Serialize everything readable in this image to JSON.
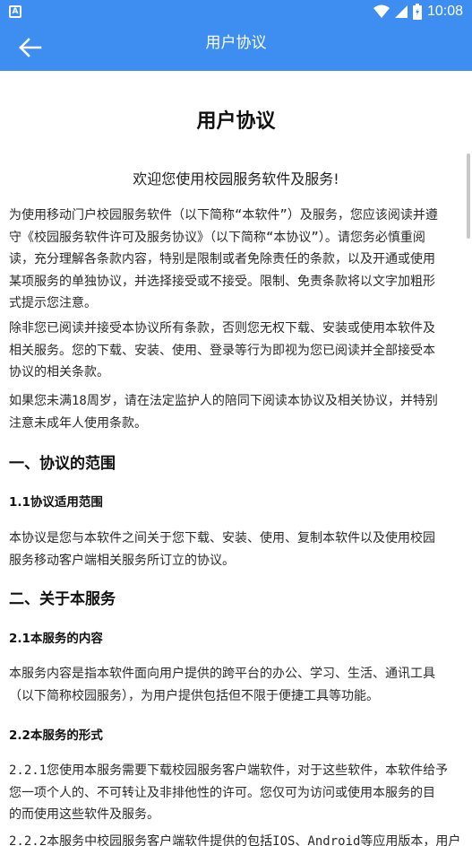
{
  "status_bar": {
    "time": "10:08",
    "left_icon": "A",
    "icons": [
      "wifi-icon",
      "signal-icon",
      "battery-icon"
    ]
  },
  "app_bar": {
    "title": "用户协议",
    "back_icon": "arrow-left-icon"
  },
  "document": {
    "title": "用户协议",
    "welcome": "欢迎您使用校园服务软件及服务!",
    "paragraphs": {
      "p1": "为使用移动门户校园服务软件（以下简称“本软件”）及服务，您应该阅读并遵\n守《校园服务软件许可及服务协议》（以下简称“本协议”）。请您务必慎重阅\n读，充分理解各条款内容，特别是限制或者免除责任的条款，以及开通或使用\n某项服务的单独协议，并选择接受或不接受。限制、免责条款将以文字加粗形\n式提示您注意。",
      "p2": "除非您已阅读并接受本协议所有条款，否则您无权下载、安装或使用本软件及\n相关服务。您的下载、安装、使用、登录等行为即视为您已阅读并全部接受本\n协议的相关条款。",
      "p3": "如果您未满18周岁，请在法定监护人的陪同下阅读本协议及相关协议，并特别\n注意未成年人使用条款。",
      "p4": "本协议是您与本软件之间关于您下载、安装、使用、复制本软件以及使用校园\n服务移动客户端相关服务所订立的协议。",
      "p5": "本服务内容是指本软件面向用户提供的跨平台的办公、学习、生活、通讯工具\n（以下简称校园服务），为用户提供包括但不限于便捷工具等功能。",
      "p6": "2.2.1您使用本服务需要下载校园服务客户端软件，对于这些软件，本软件给予\n您一项个人的、不可转让及非排他性的许可。您仅可为访问或使用本服务的目\n的而使用这些软件及服务。",
      "p7": "2.2.2本服务中校园服务客户端软件提供的包括IOS、Android等应用版本，用户"
    },
    "headings": {
      "s1": "一、协议的范围",
      "s1_1": "1.1协议适用范围",
      "s2": "二、关于本服务",
      "s2_1": "2.1本服务的内容",
      "s2_2": "2.2本服务的形式"
    }
  },
  "colors": {
    "primary": "#3d8ef0",
    "text": "#2a2a2a",
    "background": "#ffffff"
  }
}
